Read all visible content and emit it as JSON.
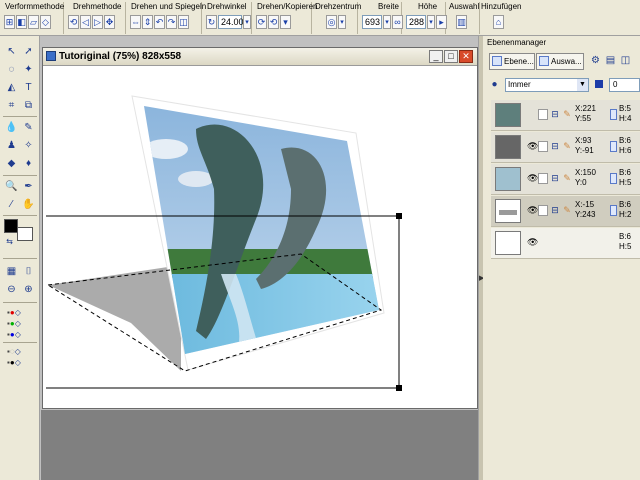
{
  "toolbar": {
    "groups": [
      {
        "label": "Verformmethode",
        "icons": [
          "warp-icon-1",
          "warp-icon-2",
          "warp-icon-3",
          "warp-icon-4"
        ]
      },
      {
        "label": "Drehmethode",
        "icons": [
          "rotate-method-icon-1",
          "rotate-method-icon-2",
          "rotate-method-icon-3",
          "rotate-method-icon-4"
        ]
      },
      {
        "label": "Drehen und Spiegeln",
        "icons": [
          "flip-horizontal-icon",
          "flip-vertical-icon",
          "rotate-left-icon",
          "rotate-right-icon"
        ]
      },
      {
        "label": "Drehwinkel",
        "value": "24.00"
      },
      {
        "label": "Drehen/Kopieren",
        "icons": [
          "rotate-copy-icon-1",
          "rotate-copy-icon-2"
        ]
      },
      {
        "label": "Drehzentrum",
        "icons": [
          "rotation-center-icon"
        ]
      },
      {
        "label": "Breite",
        "value": "693"
      },
      {
        "label": "Höhe",
        "value": "288"
      },
      {
        "label": "Auswahl",
        "icons": [
          "selection-icon"
        ]
      },
      {
        "label": "Hinzufügen",
        "icons": [
          "add-icon"
        ]
      }
    ]
  },
  "document": {
    "title": "Tutoriginal (75%) 828x558"
  },
  "panel": {
    "title": "Ebenenmanager",
    "tabs": [
      "Ebene...",
      "Auswa..."
    ],
    "mode": "Immer",
    "opacity": "0"
  },
  "layers": [
    {
      "x": "X:221",
      "y": "Y:55",
      "b": "B:5",
      "h": "H:4",
      "selected": false
    },
    {
      "x": "X:93",
      "y": "Y:-91",
      "b": "B:6",
      "h": "H:6",
      "selected": false
    },
    {
      "x": "X:150",
      "y": "Y:0",
      "b": "B:6",
      "h": "H:5",
      "selected": false
    },
    {
      "x": "X:-15",
      "y": "Y:243",
      "b": "B:6",
      "h": "H:2",
      "selected": true
    },
    {
      "x": "",
      "y": "",
      "b": "B:6",
      "h": "H:5",
      "selected": false
    }
  ],
  "colors": {
    "foreground": "#000000",
    "background": "#ffffff",
    "panel_bg": "#ece9d8",
    "workspace": "#808080"
  }
}
